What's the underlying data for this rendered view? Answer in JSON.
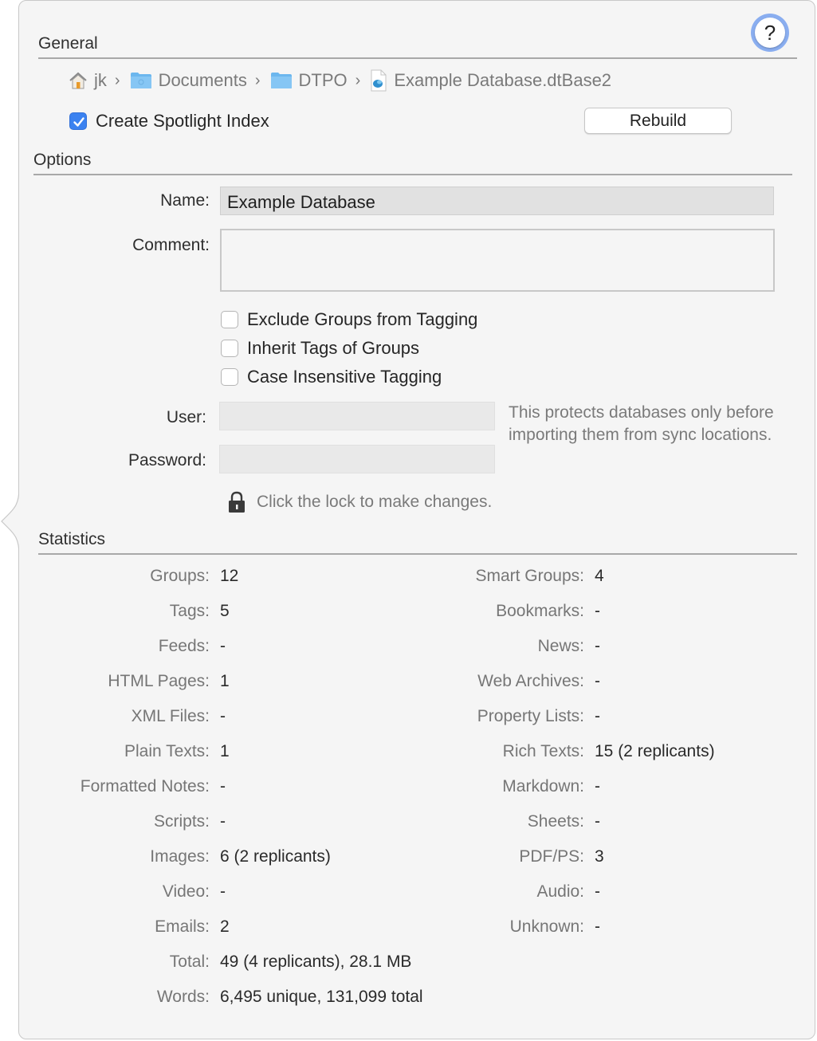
{
  "help_button": {
    "label": "?"
  },
  "general": {
    "title": "General",
    "path": [
      {
        "icon": "home-icon",
        "label": "jk"
      },
      {
        "icon": "documents-folder-icon",
        "label": "Documents"
      },
      {
        "icon": "folder-icon",
        "label": "DTPO"
      },
      {
        "icon": "database-file-icon",
        "label": "Example Database.dtBase2"
      }
    ],
    "spotlight": {
      "label": "Create Spotlight Index",
      "checked": true
    },
    "rebuild_label": "Rebuild"
  },
  "options": {
    "title": "Options",
    "name_label": "Name:",
    "name_value": "Example Database",
    "comment_label": "Comment:",
    "comment_value": "",
    "checkboxes": [
      {
        "label": "Exclude Groups from Tagging",
        "checked": false
      },
      {
        "label": "Inherit Tags of Groups",
        "checked": false
      },
      {
        "label": "Case Insensitive Tagging",
        "checked": false
      }
    ],
    "user_label": "User:",
    "user_value": "",
    "password_label": "Password:",
    "password_value": "",
    "protection_note": "This protects databases only before importing them from sync locations.",
    "lock_text": "Click the lock to make changes."
  },
  "statistics": {
    "title": "Statistics",
    "left": [
      {
        "label": "Groups:",
        "value": "12"
      },
      {
        "label": "Tags:",
        "value": "5"
      },
      {
        "label": "Feeds:",
        "value": "-"
      },
      {
        "label": "HTML Pages:",
        "value": "1"
      },
      {
        "label": "XML Files:",
        "value": "-"
      },
      {
        "label": "Plain Texts:",
        "value": "1"
      },
      {
        "label": "Formatted Notes:",
        "value": "-"
      },
      {
        "label": "Scripts:",
        "value": "-"
      },
      {
        "label": "Images:",
        "value": "6 (2 replicants)"
      },
      {
        "label": "Video:",
        "value": "-"
      },
      {
        "label": "Emails:",
        "value": "2"
      },
      {
        "label": "Total:",
        "value": "49 (4 replicants), 28.1 MB"
      },
      {
        "label": "Words:",
        "value": "6,495 unique, 131,099 total"
      }
    ],
    "right": [
      {
        "label": "Smart Groups:",
        "value": "4"
      },
      {
        "label": "Bookmarks:",
        "value": "-"
      },
      {
        "label": "News:",
        "value": "-"
      },
      {
        "label": "Web Archives:",
        "value": "-"
      },
      {
        "label": "Property Lists:",
        "value": "-"
      },
      {
        "label": "Rich Texts:",
        "value": "15 (2 replicants)"
      },
      {
        "label": "Markdown:",
        "value": "-"
      },
      {
        "label": "Sheets:",
        "value": "-"
      },
      {
        "label": "PDF/PS:",
        "value": "3"
      },
      {
        "label": "Audio:",
        "value": "-"
      },
      {
        "label": "Unknown:",
        "value": "-"
      }
    ]
  },
  "colors": {
    "accent": "#3b82f0",
    "help_ring": "#8aaef0",
    "panel_bg": "#f5f5f5"
  }
}
